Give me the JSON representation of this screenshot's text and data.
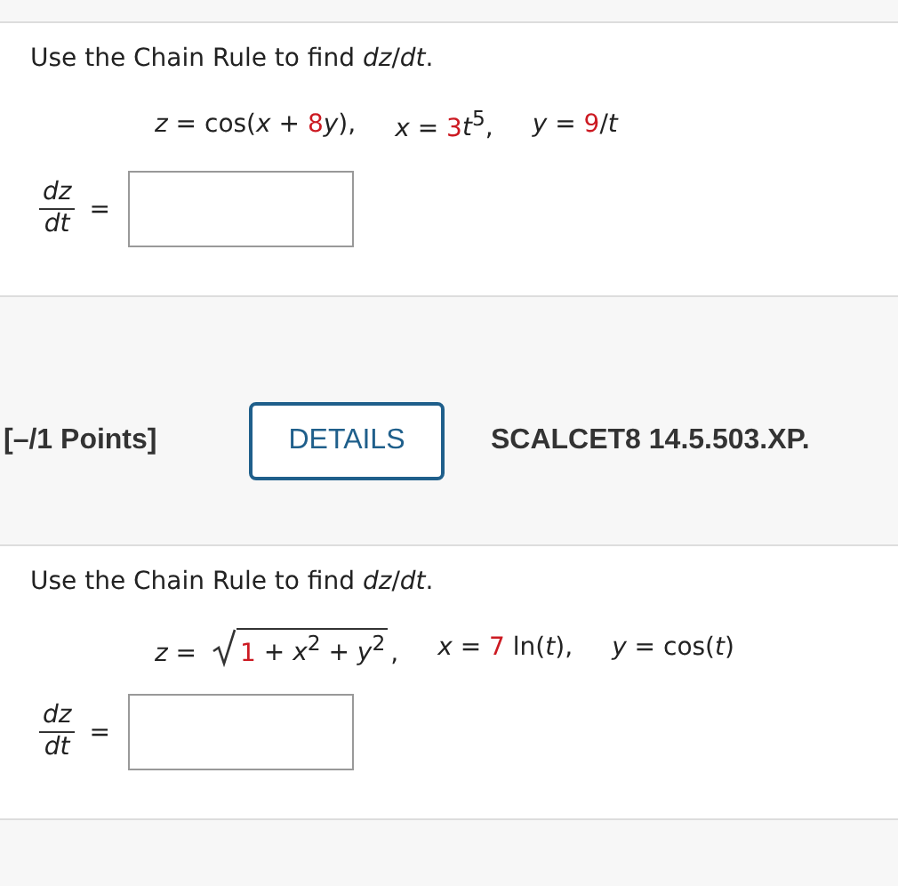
{
  "problems": [
    {
      "prompt": "Use the Chain Rule to find *dz*/*dt*.",
      "equations": [
        [
          {
            "kind": "text",
            "text": "*z* = cos(*x* + ",
            "red": false
          },
          {
            "kind": "text",
            "text": "8",
            "red": true
          },
          {
            "kind": "text",
            "text": "*y*),",
            "red": false
          }
        ],
        [
          {
            "kind": "text",
            "text": "*x* = ",
            "red": false
          },
          {
            "kind": "text",
            "text": "3",
            "red": true
          },
          {
            "kind": "text",
            "text": "*t*$^{5}$,",
            "red": false
          }
        ],
        [
          {
            "kind": "text",
            "text": "*y* = ",
            "red": false
          },
          {
            "kind": "text",
            "text": "9",
            "red": true
          },
          {
            "kind": "text",
            "text": "/*t*",
            "red": false
          }
        ]
      ],
      "answer": {
        "numerator": "dz",
        "denominator": "dt",
        "equals": "="
      }
    },
    {
      "header": {
        "points": "[–/1 Points]",
        "button": "DETAILS",
        "code": "SCALCET8 14.5.503.XP."
      },
      "prompt": "Use the Chain Rule to find *dz*/*dt*.",
      "equations": [
        [
          {
            "kind": "text",
            "text": "*z* = ",
            "red": false
          },
          {
            "kind": "radical",
            "children": [
              {
                "kind": "text",
                "text": "1",
                "red": true
              },
              {
                "kind": "text",
                "text": " + *x*$^{2}$ + *y*$^{2}$",
                "red": false
              }
            ]
          },
          {
            "kind": "text",
            "text": ",",
            "red": false
          }
        ],
        [
          {
            "kind": "text",
            "text": "*x* = ",
            "red": false
          },
          {
            "kind": "text",
            "text": "7",
            "red": true
          },
          {
            "kind": "text",
            "text": " ln(*t*),",
            "red": false
          }
        ],
        [
          {
            "kind": "text",
            "text": "*y* = cos(*t*)",
            "red": false
          }
        ]
      ],
      "answer": {
        "numerator": "dz",
        "denominator": "dt",
        "equals": "="
      }
    }
  ]
}
